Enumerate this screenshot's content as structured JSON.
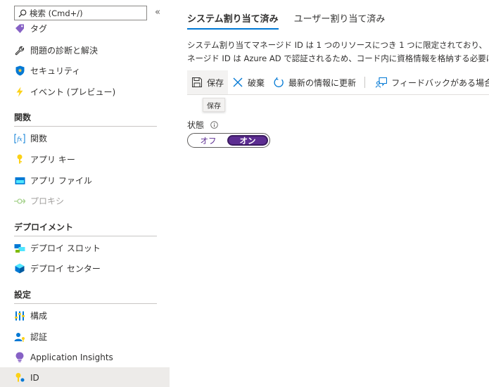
{
  "search": {
    "placeholder": "検索 (Cmd+/)"
  },
  "collapse_glyph": "«",
  "sidebar": {
    "top_items": [
      {
        "label": "タグ",
        "icon": "tag-icon"
      },
      {
        "label": "問題の診断と解決",
        "icon": "wrench-icon"
      },
      {
        "label": "セキュリティ",
        "icon": "shield-icon"
      },
      {
        "label": "イベント (プレビュー)",
        "icon": "lightning-icon"
      }
    ],
    "sections": [
      {
        "title": "関数",
        "items": [
          {
            "label": "関数",
            "icon": "function-icon"
          },
          {
            "label": "アプリ キー",
            "icon": "key-icon"
          },
          {
            "label": "アプリ ファイル",
            "icon": "app-files-icon"
          },
          {
            "label": "プロキシ",
            "icon": "proxy-icon",
            "disabled": true
          }
        ]
      },
      {
        "title": "デプロイメント",
        "items": [
          {
            "label": "デプロイ スロット",
            "icon": "deployment-slots-icon"
          },
          {
            "label": "デプロイ センター",
            "icon": "deployment-center-icon"
          }
        ]
      },
      {
        "title": "設定",
        "items": [
          {
            "label": "構成",
            "icon": "configuration-icon"
          },
          {
            "label": "認証",
            "icon": "authentication-icon"
          },
          {
            "label": "Application Insights",
            "icon": "app-insights-icon"
          },
          {
            "label": "ID",
            "icon": "identity-icon",
            "selected": true
          }
        ]
      }
    ]
  },
  "main": {
    "tabs": [
      {
        "label": "システム割り当て済み",
        "active": true
      },
      {
        "label": "ユーザー割り当て済み",
        "active": false
      }
    ],
    "description": [
      "システム割り当てマネージド ID は 1 つのリソースにつき 1 つに限定されており、",
      "ネージド ID は Azure AD で認証されるため、コード内に資格情報を格納する必要は"
    ],
    "toolbar": {
      "save": "保存",
      "discard": "破棄",
      "refresh": "最新の情報に更新",
      "feedback": "フィードバックがある場合"
    },
    "tooltip": "保存",
    "status": {
      "label": "状態",
      "off": "オフ",
      "on": "オン",
      "value": "オン"
    }
  },
  "colors": {
    "accent": "#0078d4",
    "toggle_on": "#5c2d91"
  }
}
